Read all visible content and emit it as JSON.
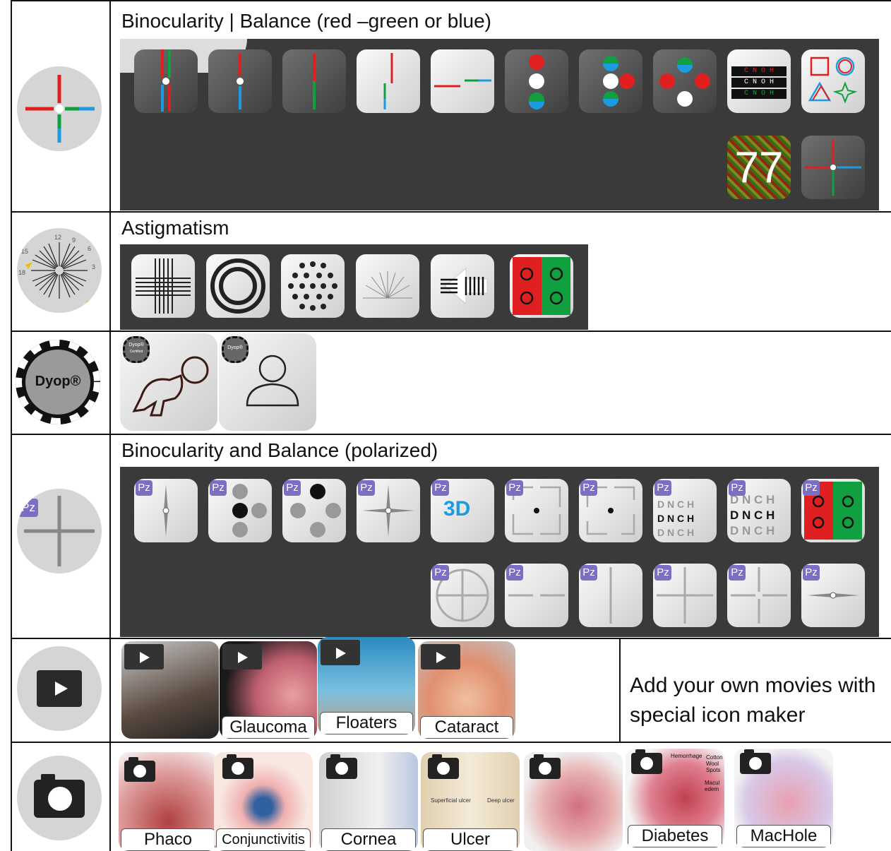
{
  "rows": {
    "binocularity_rg": {
      "title": "Binocularity | Balance (red –green or blue)",
      "icon": "red-green-cross-icon"
    },
    "astigmatism": {
      "title": "Astigmatism",
      "icon": "astigmatism-fan-icon",
      "fan_numbers": [
        "12",
        "9",
        "6",
        "3",
        "15",
        "18"
      ]
    },
    "dyop": {
      "logo_text": "Dyop®",
      "badge_text": "Dyop®",
      "badge_subtext": "Certified"
    },
    "binocularity_pol": {
      "title": "Binocularity and Balance (polarized)",
      "icon": "polarized-cross-icon",
      "pz_label": "Pz"
    },
    "movies": {
      "icon": "film-play-icon",
      "items": [
        "",
        "Glaucoma",
        "Floaters",
        "Cataract"
      ],
      "note": "Add your own movies with special icon maker"
    },
    "photos": {
      "icon": "camera-icon",
      "items": [
        "Phaco",
        "Conjunctivitis",
        "Cornea",
        "Ulcer",
        "",
        "Diabetes",
        "MacHole"
      ],
      "diabetes_annotations": [
        "Hemorrhage",
        "Cotton Wool Spots",
        "Macul edem"
      ],
      "ulcer_annotations": [
        "Superficial ulcer",
        "Deep ulcer"
      ]
    }
  },
  "tiles": {
    "duochrome_letters": [
      "C N O H",
      "C N O H",
      "C N O H"
    ],
    "ishihara_number": "77",
    "dnch_letters": [
      "D N C H",
      "D N C H",
      "D N C H"
    ],
    "stereo_label": "3D"
  },
  "colors": {
    "red": "#e02020",
    "green": "#10a040",
    "blue": "#1e9be0",
    "panel": "#3a3a3a",
    "pz": "#7a6fc2"
  }
}
